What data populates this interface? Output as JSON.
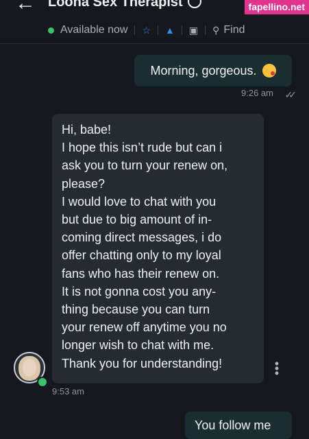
{
  "header": {
    "title": "Loona Sex Therapist",
    "back_icon": "arrow-left-icon",
    "verified_icon": "verified-badge-icon",
    "status": "Available now",
    "search_label": "Find",
    "status_color": "#3cc26b",
    "accent_color": "#2f8fe8"
  },
  "watermark": "fapellino.net",
  "messages": [
    {
      "direction": "outgoing",
      "text": "Morning, gorgeous.",
      "emoji": "kissing-face-emoji",
      "time": "9:26 am"
    },
    {
      "direction": "incoming",
      "lines": [
        "Hi, babe!",
        "I hope this isn’t rude but can i",
        "ask you to turn your renew on,",
        "please?",
        "I would love to chat with you",
        "but due to big amount of in-",
        "coming direct messages, i do",
        "offer chatting only to my loyal",
        "fans who has their renew on.",
        "It is not gonna cost you any-",
        "thing because you can turn",
        "your renew off anytime you no",
        "longer wish to chat with me.",
        "Thank you for understanding!"
      ],
      "time": "9:53 am"
    },
    {
      "direction": "outgoing",
      "text": "You follow me"
    }
  ]
}
